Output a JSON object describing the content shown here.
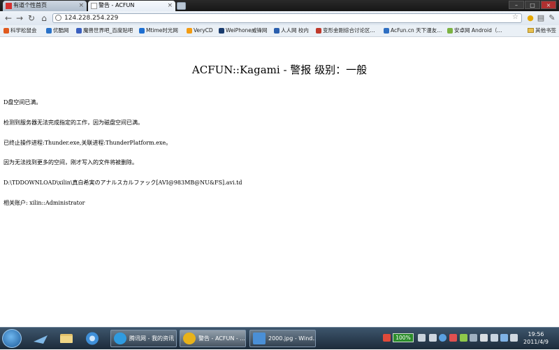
{
  "browser": {
    "tabs": [
      {
        "label": "有道个性首页",
        "icon_color": "#d4302f",
        "active": false
      },
      {
        "label": "警告 - ACFUN",
        "icon_color": "#ffffff",
        "active": true
      }
    ],
    "url": "124.228.254.229",
    "bookmarks": [
      {
        "label": "科学松鼠会",
        "icon_color": "#e05a1e"
      },
      {
        "label": "优酷网",
        "icon_color": "#2a72c8"
      },
      {
        "label": "魔兽世界吧_百度贴吧",
        "icon_color": "#3a5fbf"
      },
      {
        "label": "Mtime时光网",
        "icon_color": "#1e6fd1"
      },
      {
        "label": "VeryCD",
        "icon_color": "#f39c12"
      },
      {
        "label": "WeiPhone威锋网",
        "icon_color": "#1a3c6e"
      },
      {
        "label": "人人网 校内",
        "icon_color": "#2b5fae"
      },
      {
        "label": "变形金刚综合讨论区...",
        "icon_color": "#c0392b"
      },
      {
        "label": "AcFun.cn 天下漫友...",
        "icon_color": "#2f6fc2"
      },
      {
        "label": "安卓网 Android（...",
        "icon_color": "#7cb342"
      }
    ],
    "other_bookmarks": "其他书签"
  },
  "page": {
    "title": "ACFUN::Kagami - 警报 级别：一般",
    "lines": [
      "D盘空间已满。",
      "检测到服务器无法完成指定的工作，因为磁盘空间已满。",
      "已终止操作进程:Thunder.exe,关联进程:ThunderPlatform.exe。",
      "因为无法找到更多的空间，刚才写入的文件将被删除。",
      "D:\\TDDOWNLOAD\\xilin\\真白希実のアナルスカルファック[AVI@983MB@NU&FS].avi.td",
      "相关账户: xilin::Administrator"
    ]
  },
  "taskbar": {
    "tasks": [
      {
        "label": "腾讯网 - 我的资讯",
        "icon_color": "#2f9be0",
        "active": false
      },
      {
        "label": "警告 - ACFUN - ...",
        "icon_color": "#e8b21a",
        "active": true
      },
      {
        "label": "2000.jpg - Wind...",
        "icon_color": "#4a8fd6",
        "active": false
      }
    ],
    "battery": "100%",
    "time": "19:56",
    "date": "2011/4/9"
  }
}
